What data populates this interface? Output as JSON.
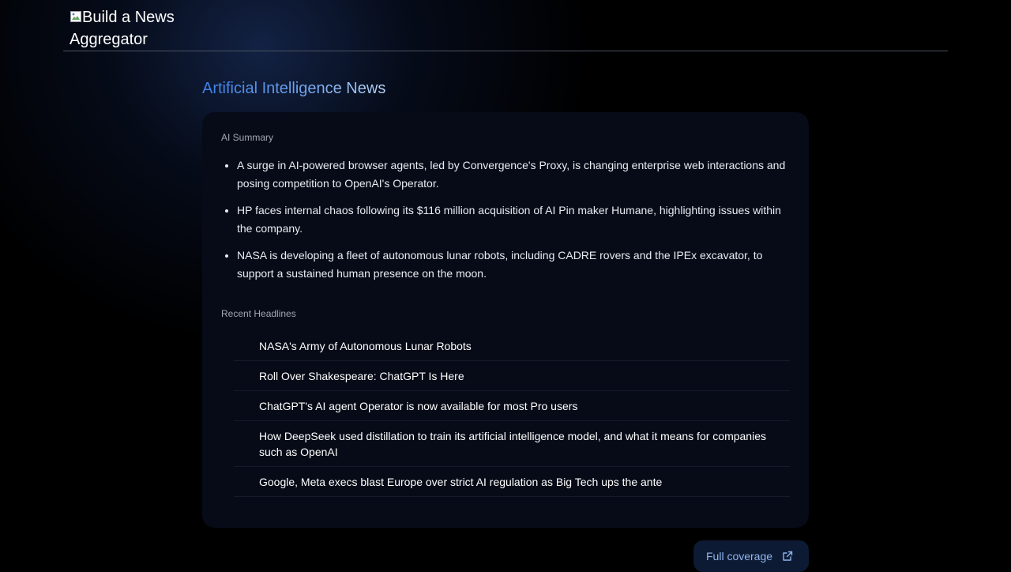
{
  "header": {
    "logo_alt": "Build a News Aggregator"
  },
  "page": {
    "title": "Artificial Intelligence News"
  },
  "summary": {
    "label": "AI Summary",
    "items": [
      "A surge in AI-powered browser agents, led by Convergence's Proxy, is changing enterprise web interactions and posing competition to OpenAI's Operator.",
      "HP faces internal chaos following its $116 million acquisition of AI Pin maker Humane, highlighting issues within the company.",
      "NASA is developing a fleet of autonomous lunar robots, including CADRE rovers and the IPEx excavator, to support a sustained human presence on the moon."
    ]
  },
  "headlines": {
    "label": "Recent Headlines",
    "items": [
      "NASA's Army of Autonomous Lunar Robots",
      "Roll Over Shakespeare: ChatGPT Is Here",
      "ChatGPT's AI agent Operator is now available for most Pro users",
      "How DeepSeek used distillation to train its artificial intelligence model, and what it means for companies such as OpenAI",
      "Google, Meta execs blast Europe over strict AI regulation as Big Tech ups the ante"
    ]
  },
  "actions": {
    "full_coverage_label": "Full coverage",
    "full_coverage_icon": "external-link-icon"
  },
  "colors": {
    "background": "#000000",
    "card": "#060b17",
    "accent": "#8fb5ee",
    "title_gradient_start": "#3d7fe6",
    "title_gradient_end": "#b9d3f7"
  }
}
